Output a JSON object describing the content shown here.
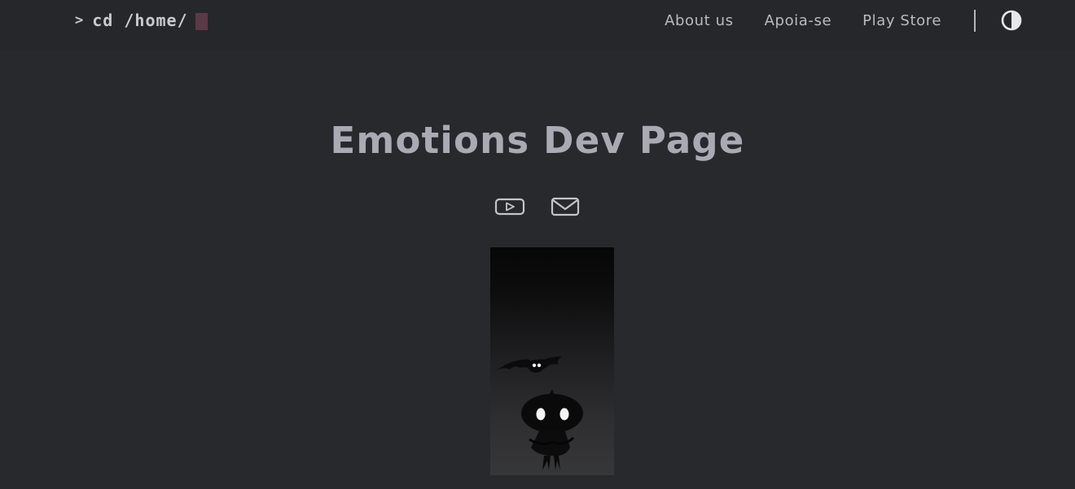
{
  "header": {
    "prompt_symbol": ">",
    "prompt_command": "cd /home/",
    "nav": [
      {
        "label": "About us"
      },
      {
        "label": "Apoia-se"
      },
      {
        "label": "Play Store"
      }
    ],
    "theme_toggle_icon": "contrast-icon"
  },
  "main": {
    "title": "Emotions Dev Page",
    "social_icons": [
      "youtube-icon",
      "mail-icon"
    ],
    "hero_image": "character-with-bat-illustration"
  },
  "colors": {
    "background": "#28292d",
    "header_background": "#26272b",
    "title": "#a9aab4",
    "nav_text": "#b9bbc0",
    "cursor": "#5a3a45"
  }
}
